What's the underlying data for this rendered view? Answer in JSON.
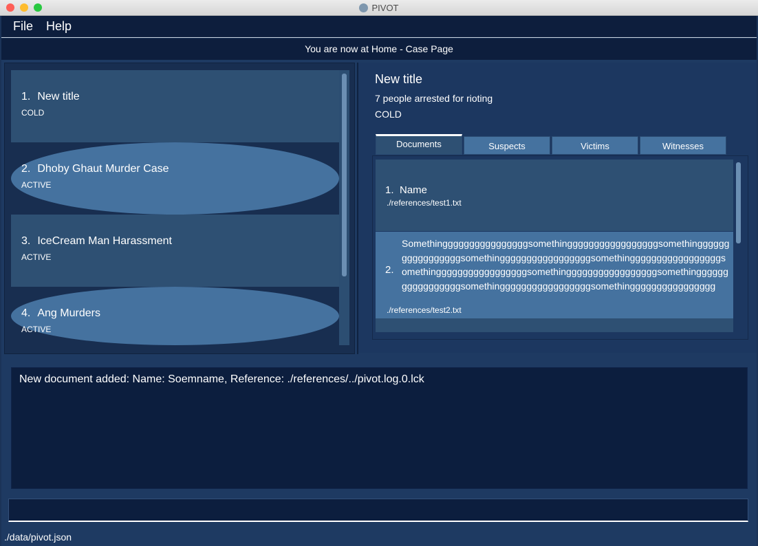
{
  "window": {
    "title": "PIVOT"
  },
  "menu": {
    "items": [
      "File",
      "Help"
    ]
  },
  "location": "You are now at Home - Case Page",
  "cases": [
    {
      "index": "1.",
      "title": "New title",
      "status": "COLD"
    },
    {
      "index": "2.",
      "title": "Dhoby Ghaut Murder Case",
      "status": "ACTIVE"
    },
    {
      "index": "3.",
      "title": "IceCream Man Harassment",
      "status": "ACTIVE"
    },
    {
      "index": "4.",
      "title": "Ang Murders",
      "status": "ACTIVE"
    }
  ],
  "detail": {
    "title": "New title",
    "description": "7 people arrested for rioting",
    "status": "COLD",
    "tabs": [
      "Documents",
      "Suspects",
      "Victims",
      "Witnesses"
    ],
    "selected_tab": "Documents",
    "documents": [
      {
        "index": "1.",
        "name": "Name",
        "reference": "./references/test1.txt"
      },
      {
        "index": "2.",
        "name": "Somethinggggggggggggggggsomethingggggggggggggggggsomethingggggggggggggggggsomethingggggggggggggggggsomethingggggggggggggggggsomethingggggggggggggggggsomethingggggggggggggggggsomethingggggggggggggggggsomethingggggggggggggggggsomethingggggggggggggggg",
        "reference": "./references/test2.txt"
      }
    ]
  },
  "result": "New document added: Name: Soemname, Reference: ./references/../pivot.log.0.lck",
  "command": {
    "value": ""
  },
  "status_bar": "./data/pivot.json",
  "colors": {
    "background": "#1b3358",
    "menubar": "#0d1e3d",
    "card_dark": "#2e5073",
    "card_light": "#45729f",
    "result_bg": "#0c1e3e"
  }
}
